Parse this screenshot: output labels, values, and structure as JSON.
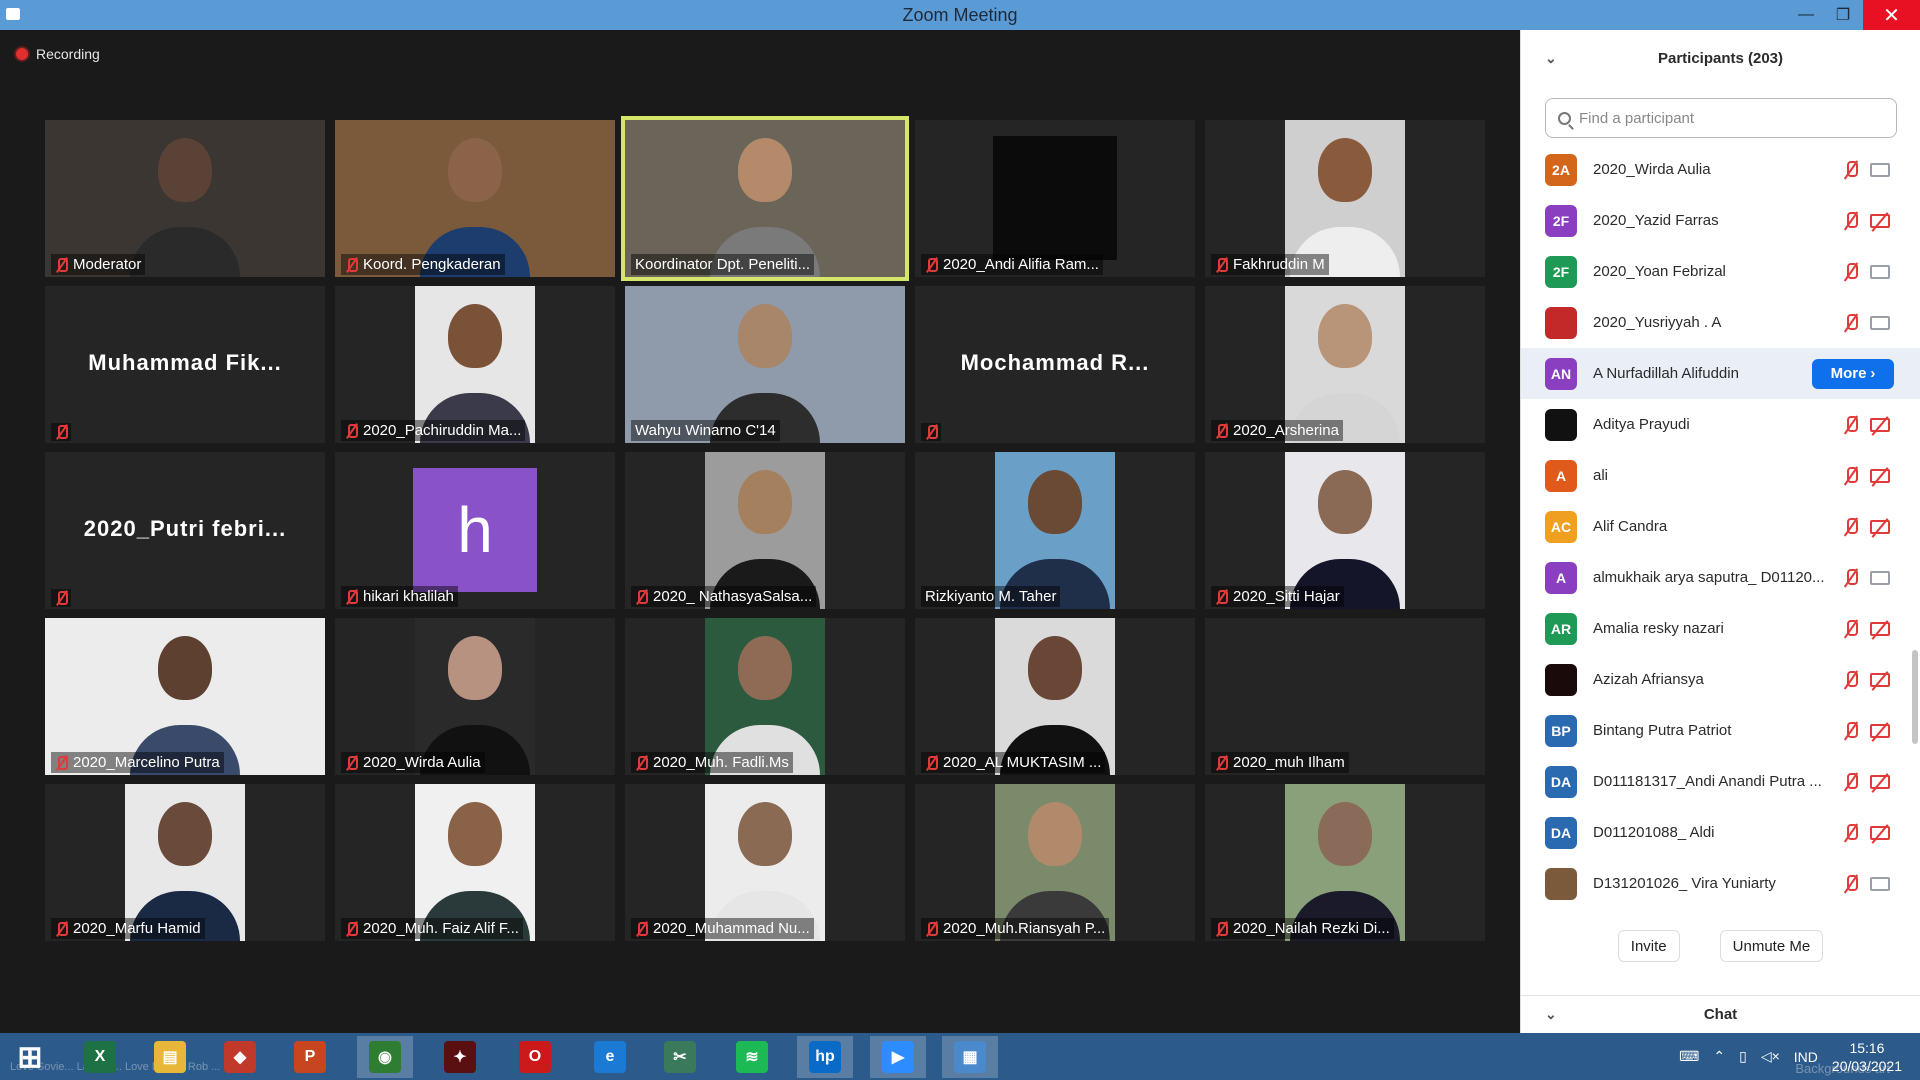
{
  "window": {
    "title": "Zoom Meeting",
    "minimize": "—",
    "maximize": "❐",
    "close": "✕"
  },
  "recording": {
    "label": "Recording"
  },
  "tiles": [
    {
      "name": "Moderator",
      "muted": true,
      "kind": "video",
      "bg": "#3b3632",
      "skin": "#5a4236",
      "shirt": "#2a2a2a"
    },
    {
      "name": "Koord. Pengkaderan",
      "muted": true,
      "kind": "video",
      "bg": "#7b5a3c",
      "skin": "#8a6348",
      "shirt": "#1d3d6e"
    },
    {
      "name": "Koordinator Dpt. Peneliti...",
      "muted": false,
      "active": true,
      "kind": "video",
      "bg": "#6b6458",
      "skin": "#b58a6a",
      "shirt": "#7a7a7a"
    },
    {
      "name": "2020_Andi Alifia Ram...",
      "muted": true,
      "kind": "dark",
      "bg": "#0b0b0b"
    },
    {
      "name": "Fakhruddin M",
      "muted": true,
      "kind": "portrait",
      "bg": "#cfcfcf",
      "skin": "#8a5a3c",
      "shirt": "#eeeeee"
    },
    {
      "name": "",
      "big_name": "Muhammad  Fik...",
      "muted": true,
      "kind": "name"
    },
    {
      "name": "2020_Pachiruddin Ma...",
      "muted": true,
      "kind": "portrait",
      "bg": "#e6e6e6",
      "skin": "#7a5238",
      "shirt": "#3a3a4a"
    },
    {
      "name": "Wahyu Winarno C'14",
      "muted": false,
      "kind": "video",
      "bg": "#8f9bab",
      "skin": "#a7866a",
      "shirt": "#2d2d2d"
    },
    {
      "name": "",
      "big_name": "Mochammad  R...",
      "muted": true,
      "kind": "name"
    },
    {
      "name": "2020_Arsherina",
      "muted": true,
      "kind": "portrait",
      "bg": "#d9d9d9",
      "skin": "#b89478",
      "shirt": "#d5d5d5"
    },
    {
      "name": "",
      "big_name": "2020_Putri  febri...",
      "muted": true,
      "kind": "name"
    },
    {
      "name": "hikari khalilah",
      "muted": true,
      "kind": "avatar",
      "letter": "h"
    },
    {
      "name": "2020_ NathasyaSalsa...",
      "muted": true,
      "kind": "portrait",
      "bg": "#9c9c9c",
      "skin": "#a5805f",
      "shirt": "#1a1a1a"
    },
    {
      "name": "Rizkiyanto M. Taher",
      "muted": false,
      "kind": "portrait",
      "bg": "#6aa0c8",
      "skin": "#6a4a34",
      "shirt": "#1f2f4a"
    },
    {
      "name": "2020_Sitti Hajar",
      "muted": true,
      "kind": "portrait",
      "bg": "#e8e8ec",
      "skin": "#8a6a55",
      "shirt": "#15152a"
    },
    {
      "name": "2020_Marcelino Putra",
      "muted": true,
      "kind": "video",
      "bg": "#ececec",
      "skin": "#5e4030",
      "shirt": "#3a4a6a"
    },
    {
      "name": "2020_Wirda Aulia",
      "muted": true,
      "kind": "portrait",
      "bg": "#2a2a2a",
      "skin": "#b89280",
      "shirt": "#111111"
    },
    {
      "name": "2020_Muh. Fadli.Ms",
      "muted": true,
      "kind": "portrait",
      "bg": "#2c5a3e",
      "skin": "#8f6a55",
      "shirt": "#e0e0e0"
    },
    {
      "name": "2020_AL MUKTASIM ...",
      "muted": true,
      "kind": "portrait",
      "bg": "#dadada",
      "skin": "#6a4636",
      "shirt": "#111111"
    },
    {
      "name": "2020_muh Ilham",
      "muted": true,
      "kind": "empty"
    },
    {
      "name": "2020_Marfu Hamid",
      "muted": true,
      "kind": "portrait",
      "bg": "#e8e8e8",
      "skin": "#6a4a3a",
      "shirt": "#1b2a44"
    },
    {
      "name": "2020_Muh. Faiz Alif F...",
      "muted": true,
      "kind": "portrait",
      "bg": "#f0f0f0",
      "skin": "#8a6248",
      "shirt": "#2a3a3a"
    },
    {
      "name": "2020_Muhammad Nu...",
      "muted": true,
      "kind": "portrait",
      "bg": "#ececec",
      "skin": "#8a6a52",
      "shirt": "#e6e6e6"
    },
    {
      "name": "2020_Muh.Riansyah P...",
      "muted": true,
      "kind": "portrait",
      "bg": "#7a8a6a",
      "skin": "#b08a6a",
      "shirt": "#3a3a3a"
    },
    {
      "name": "2020_Nailah Rezki Di...",
      "muted": true,
      "kind": "portrait",
      "bg": "#8aa07a",
      "skin": "#8a6a58",
      "shirt": "#1a1a2a"
    }
  ],
  "participants": {
    "collapse_icon": "⌄",
    "title": "Participants (203)",
    "search_placeholder": "Find a participant",
    "more_label": "More",
    "more_icon": "›",
    "items": [
      {
        "initials": "2A",
        "name": "2020_Wirda Aulia",
        "color": "#d4661c",
        "cam_off": false
      },
      {
        "initials": "2F",
        "name": "2020_Yazid Farras",
        "color": "#8a3fc0",
        "cam_off": true
      },
      {
        "initials": "2F",
        "name": "2020_Yoan Febrizal",
        "color": "#1f9a56",
        "cam_off": false
      },
      {
        "initials": "",
        "name": "2020_Yusriyyah . A",
        "color": "#c22a2a",
        "cam_off": false,
        "photo": true
      },
      {
        "initials": "AN",
        "name": "A Nurfadillah Alifuddin",
        "color": "#8a3fc0",
        "hover": true
      },
      {
        "initials": "",
        "name": "Aditya Prayudi",
        "color": "#111111",
        "cam_off": true
      },
      {
        "initials": "A",
        "name": "ali",
        "color": "#e05a1c",
        "cam_off": true
      },
      {
        "initials": "AC",
        "name": "Alif Candra",
        "color": "#f0a020",
        "cam_off": true
      },
      {
        "initials": "A",
        "name": "almukhaik arya saputra_ D01120...",
        "color": "#8a3fc0",
        "cam_off": false
      },
      {
        "initials": "AR",
        "name": "Amalia resky nazari",
        "color": "#1f9a56",
        "cam_off": true
      },
      {
        "initials": "",
        "name": "Azizah Afriansya",
        "color": "#1a0a0a",
        "cam_off": true
      },
      {
        "initials": "BP",
        "name": "Bintang Putra Patriot",
        "color": "#2a6ab0",
        "cam_off": true
      },
      {
        "initials": "DA",
        "name": "D011181317_Andi Anandi Putra ...",
        "color": "#2a6ab0",
        "cam_off": true
      },
      {
        "initials": "DA",
        "name": "D011201088_ Aldi",
        "color": "#2a6ab0",
        "cam_off": true
      },
      {
        "initials": "",
        "name": "D131201026_ Vira Yuniarty",
        "color": "#7a5a3a",
        "cam_off": false,
        "photo": true
      }
    ],
    "invite_label": "Invite",
    "unmute_label": "Unmute Me"
  },
  "chat": {
    "title": "Chat"
  },
  "taskbar": {
    "apps": [
      {
        "name": "windows-start",
        "glyph": "⊞",
        "color": "transparent"
      },
      {
        "name": "excel",
        "glyph": "X",
        "color": "#1e7145"
      },
      {
        "name": "file-explorer",
        "glyph": "▤",
        "color": "#e8b73a"
      },
      {
        "name": "app-red-yellow",
        "glyph": "◆",
        "color": "#c0392b"
      },
      {
        "name": "powerpoint",
        "glyph": "P",
        "color": "#c8461f"
      },
      {
        "name": "chrome",
        "glyph": "◉",
        "color": "#2e7d32"
      },
      {
        "name": "game-app",
        "glyph": "✦",
        "color": "#5a1010"
      },
      {
        "name": "opera",
        "glyph": "O",
        "color": "#cc1a1a"
      },
      {
        "name": "edge",
        "glyph": "e",
        "color": "#1a7ad4"
      },
      {
        "name": "snipping-tool",
        "glyph": "✂",
        "color": "#3a7a5a"
      },
      {
        "name": "spotify",
        "glyph": "≋",
        "color": "#1db954"
      },
      {
        "name": "hp",
        "glyph": "hp",
        "color": "#0a6ac8"
      },
      {
        "name": "zoom",
        "glyph": "▶",
        "color": "#2d8cff"
      },
      {
        "name": "control-panel",
        "glyph": "▦",
        "color": "#4a8acc"
      }
    ],
    "tray": {
      "keyboard_icon": "⌨",
      "chevron": "⌃",
      "lang": "IND",
      "time": "15:16",
      "date": "20/03/2021"
    }
  },
  "desktop_overlay": {
    "left": "Love Sovie... Lames ... Love Money Rob ... Roll",
    "right": "Backgrounds art"
  }
}
